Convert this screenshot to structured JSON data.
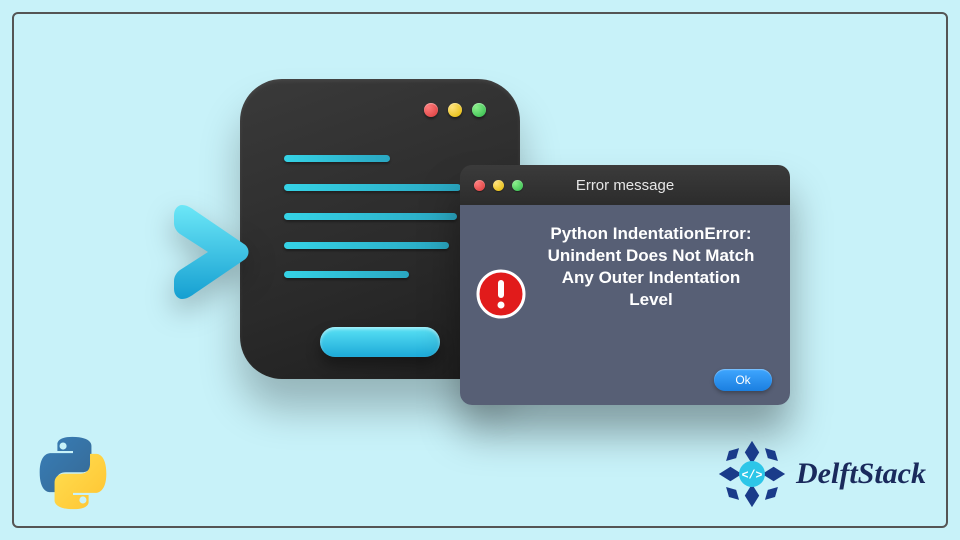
{
  "dialog": {
    "title": "Error message",
    "error_text": "Python IndentationError: Unindent Does Not Match Any Outer Indentation Level",
    "ok_label": "Ok"
  },
  "brand": {
    "name": "DelftStack"
  },
  "icons": {
    "python": "python-logo",
    "chevron": "prompt-chevron",
    "alert": "alert-icon",
    "brand_mark": "delftstack-mark"
  },
  "colors": {
    "bg": "#c8f2f9",
    "dialog_body": "#575f75",
    "accent_cyan": "#35d3e6",
    "ok_blue": "#1b7fe0",
    "alert_red": "#e11b1b"
  }
}
